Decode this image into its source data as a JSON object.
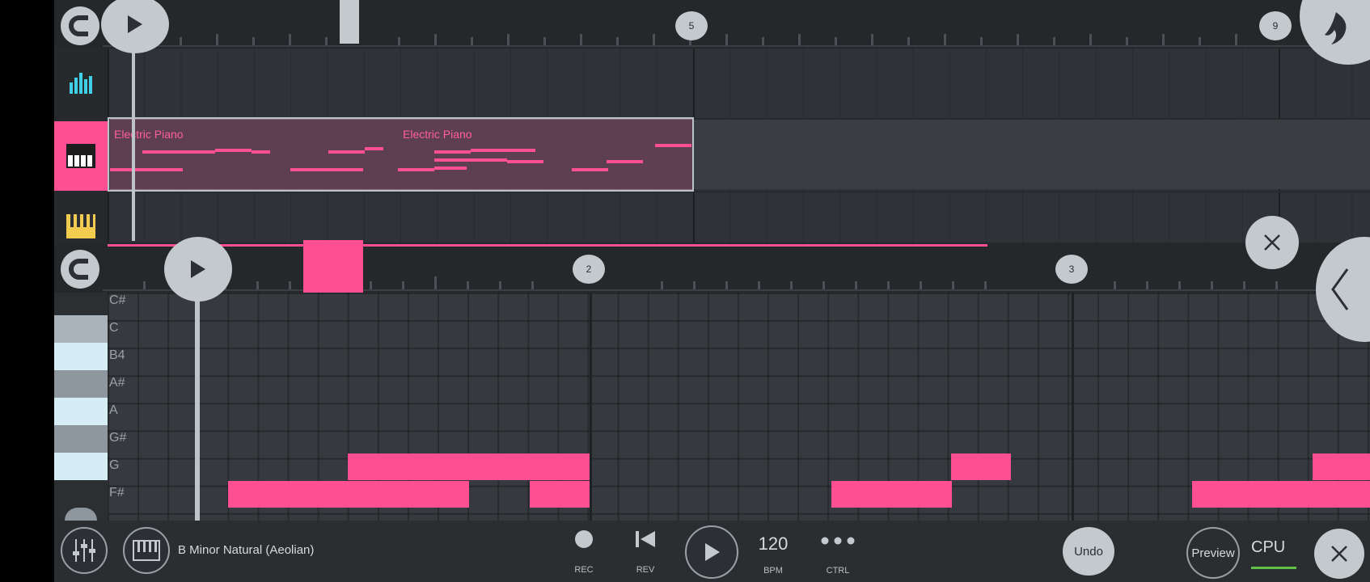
{
  "playlist": {
    "bar_markers": [
      "5",
      "9"
    ],
    "clips": [
      {
        "title": "Electric Piano"
      },
      {
        "title": "Electric Piano"
      }
    ]
  },
  "piano_roll": {
    "bar_markers": [
      "2",
      "3"
    ],
    "note_rows": [
      "C#",
      "C",
      "B4",
      "A#",
      "A",
      "G#",
      "G",
      "F#"
    ]
  },
  "toolbar": {
    "scale": "B Minor Natural (Aeolian)",
    "rec_label": "REC",
    "rev_label": "REV",
    "bpm_value": "120",
    "bpm_label": "BPM",
    "ctrl_label": "CTRL",
    "undo_label": "Undo",
    "preview_label": "Preview",
    "cpu_label": "CPU"
  },
  "colors": {
    "accent": "#ff4f93",
    "background": "#2c3034",
    "cyan_icon": "#3fd0e8",
    "yellow_icon": "#f2cc4e",
    "cpu_meter": "#62c04a"
  },
  "icons": [
    "magnet-icon",
    "play-icon",
    "mixer-bars-icon",
    "piano-keys-icon",
    "fl-logo-icon",
    "close-icon",
    "chevron-left-icon",
    "mixer-sliders-icon",
    "record-icon",
    "rewind-icon",
    "more-dots-icon"
  ]
}
